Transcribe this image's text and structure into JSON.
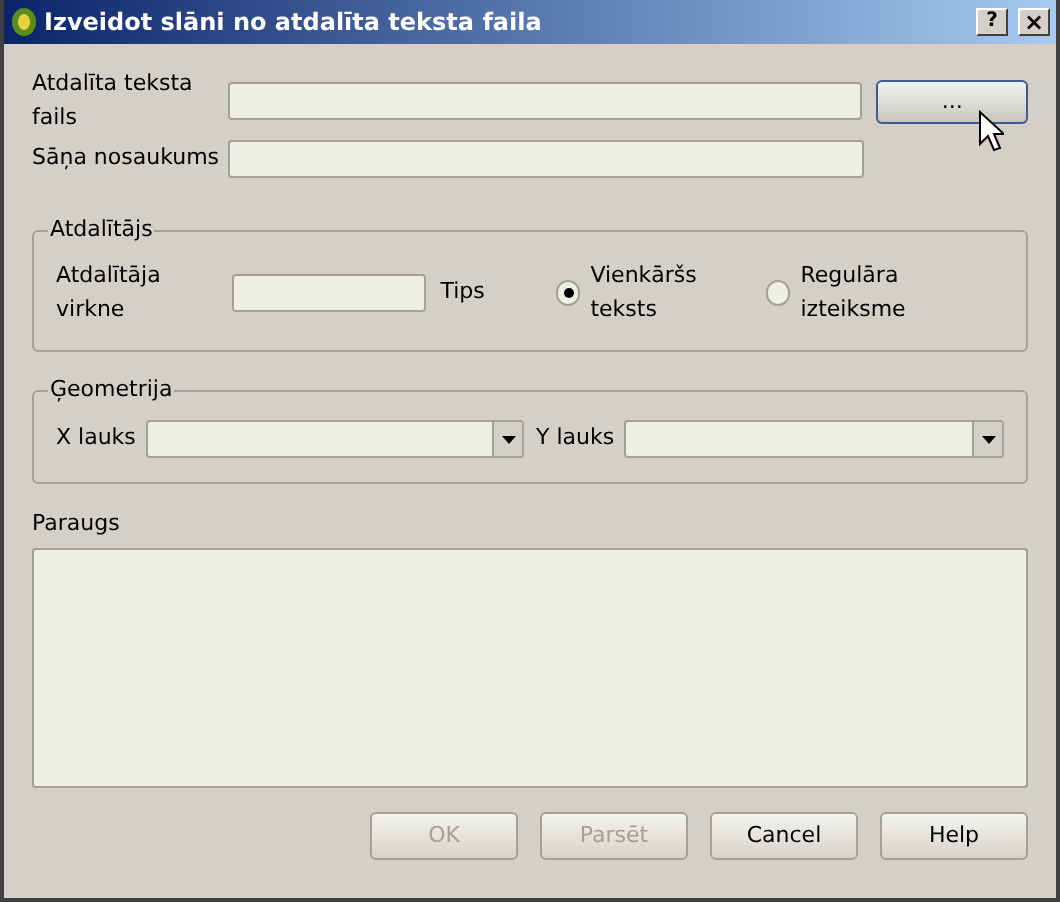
{
  "window": {
    "title": "Izveidot slāni no atdalīta teksta faila",
    "help_button": "?",
    "close_button": "×"
  },
  "file_row": {
    "label": "Atdalīta teksta fails",
    "browse_button": "..."
  },
  "layer_row": {
    "label": "Sāņa nosaukums"
  },
  "delimiter_group": {
    "title": "Atdalītājs",
    "string_label": "Atdalītāja virkne",
    "type_label": "Tips",
    "options": [
      {
        "label": "Vienkāršs teksts",
        "selected": true
      },
      {
        "label": "Regulāra izteiksme",
        "selected": false
      }
    ]
  },
  "geometry_group": {
    "title": "Ģeometrija",
    "fields": [
      {
        "label": "X lauks"
      },
      {
        "label": "Y lauks"
      }
    ]
  },
  "preview": {
    "label": "Paraugs"
  },
  "buttons": [
    {
      "label": "OK",
      "disabled": true
    },
    {
      "label": "Parsēt",
      "disabled": true
    },
    {
      "label": "Cancel",
      "disabled": false
    },
    {
      "label": "Help",
      "disabled": false
    }
  ]
}
